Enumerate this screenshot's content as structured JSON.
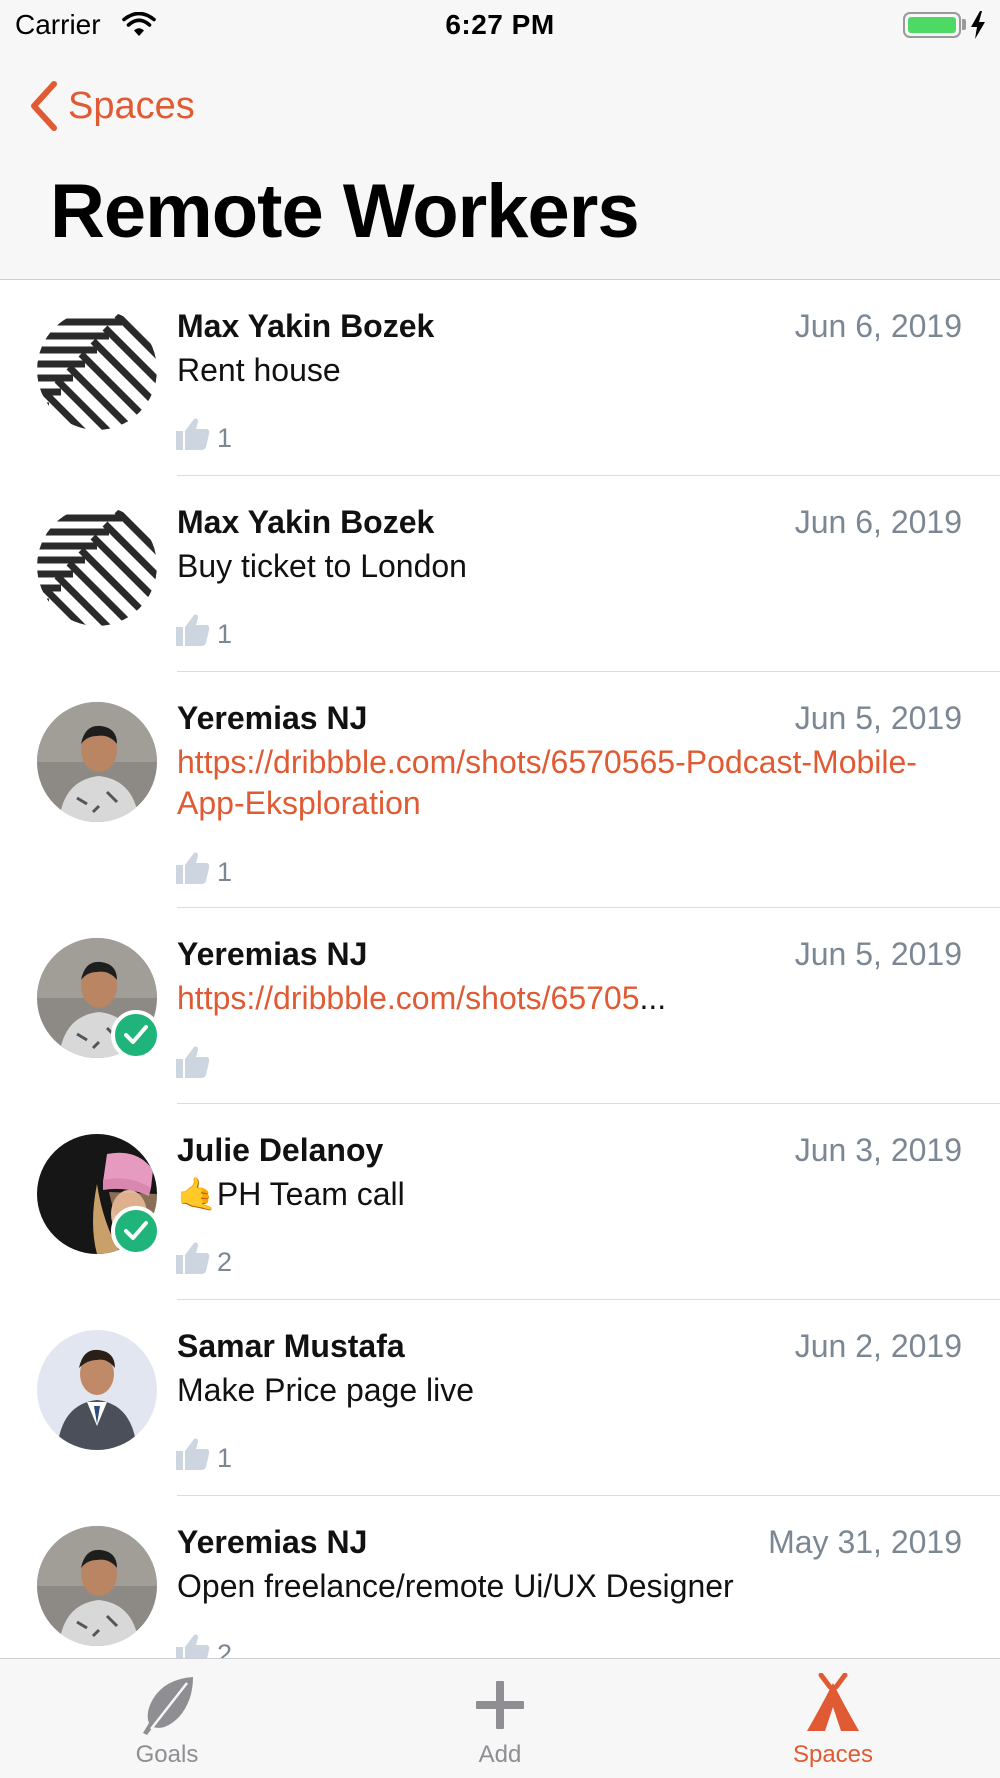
{
  "status_bar": {
    "carrier": "Carrier",
    "time": "6:27 PM",
    "battery_color": "#4cd964"
  },
  "nav": {
    "back_label": "Spaces",
    "back_icon": "chevron-left-icon",
    "title": "Remote Workers"
  },
  "colors": {
    "accent": "#e05a33",
    "check": "#1fb57a",
    "meta": "#7c8794"
  },
  "feed": [
    {
      "author": "Max Yakin Bozek",
      "date": "Jun 6, 2019",
      "message": "Rent house",
      "likes": "1",
      "avatar": "stripes-avatar"
    },
    {
      "author": "Max Yakin Bozek",
      "date": "Jun 6, 2019",
      "message": "Buy ticket to London",
      "likes": "1",
      "avatar": "stripes-avatar"
    },
    {
      "author": "Yeremias NJ",
      "date": "Jun 5, 2019",
      "message": "https://dribbble.com/shots/6570565-Podcast-Mobile-App-Eksploration",
      "likes": "1",
      "avatar": "photo-avatar"
    },
    {
      "author": "Yeremias NJ",
      "date": "Jun 5, 2019",
      "message": "https://dribbble.com/shots/65705",
      "ellipsis": "...",
      "likes": "",
      "avatar": "photo-avatar",
      "completed": true
    },
    {
      "author": "Julie Delanoy",
      "date": "Jun 3, 2019",
      "message": "🤙PH Team call",
      "likes": "2",
      "avatar": "photo-avatar",
      "completed": true
    },
    {
      "author": "Samar Mustafa",
      "date": "Jun 2, 2019",
      "message": "Make Price page live",
      "likes": "1",
      "avatar": "photo-avatar"
    },
    {
      "author": "Yeremias NJ",
      "date": "May 31, 2019",
      "message": "Open freelance/remote Ui/UX Designer",
      "likes": "2",
      "avatar": "photo-avatar"
    }
  ],
  "tabs": [
    {
      "label": "Goals",
      "icon": "feather-icon",
      "active": false
    },
    {
      "label": "Add",
      "icon": "plus-icon",
      "active": false
    },
    {
      "label": "Spaces",
      "icon": "tent-icon",
      "active": true
    }
  ]
}
